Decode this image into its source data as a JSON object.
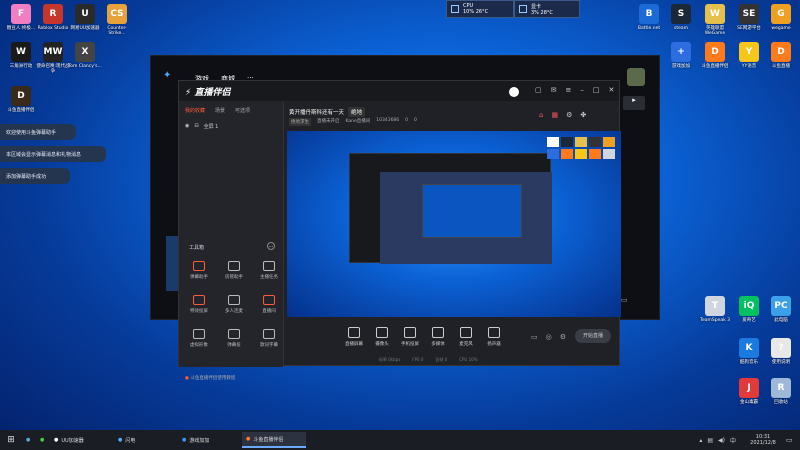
{
  "desktop_left": [
    {
      "label": "糖豆人:终极...",
      "color": "#f27ec2",
      "glyph": "F"
    },
    {
      "label": "Roblox Studio",
      "color": "#c6362b",
      "glyph": "R"
    },
    {
      "label": "网易UU加速器",
      "color": "#2a2a2a",
      "glyph": "U"
    },
    {
      "label": "Counter-Strike...",
      "color": "#e8a23a",
      "glyph": "CS"
    },
    {
      "label": "三角洲行动",
      "color": "#1a1a1a",
      "glyph": "W"
    },
    {
      "label": "使命召唤:现代战争",
      "color": "#222",
      "glyph": "MW"
    },
    {
      "label": "Tom Clancy's...",
      "color": "#444",
      "glyph": "X"
    },
    {
      "label": "斗鱼直播伴侣",
      "color": "#3a2a1a",
      "glyph": "D"
    }
  ],
  "desktop_right": [
    {
      "label": "Battle.net",
      "color": "#1b6ad6",
      "glyph": "B"
    },
    {
      "label": "steam",
      "color": "#1b2838",
      "glyph": "S"
    },
    {
      "label": "英雄联盟WeGame",
      "color": "#e5c04a",
      "glyph": "W"
    },
    {
      "label": "SE网游平台",
      "color": "#333",
      "glyph": "SE"
    },
    {
      "label": "wegame",
      "color": "#f0a020",
      "glyph": "G"
    },
    {
      "label": "游戏加加",
      "color": "#2d6de0",
      "glyph": "+"
    },
    {
      "label": "斗鱼直播伴侣",
      "color": "#ff7a1a",
      "glyph": "D"
    },
    {
      "label": "YY语音",
      "color": "#f7c61a",
      "glyph": "Y"
    },
    {
      "label": "斗鱼直播",
      "color": "#ff7a1a",
      "glyph": "D"
    },
    {
      "label": "TeamSpeak 3",
      "color": "#cfd6e0",
      "glyph": "T"
    },
    {
      "label": "爱奇艺",
      "color": "#00c060",
      "glyph": "iQ"
    },
    {
      "label": "此电脑",
      "color": "#3aa0e8",
      "glyph": "PC"
    },
    {
      "label": "酷狗音乐",
      "color": "#1a7ae0",
      "glyph": "K"
    },
    {
      "label": "使用说明",
      "color": "#e8e8e8",
      "glyph": "?"
    },
    {
      "label": "金山毒霸",
      "color": "#e03a3a",
      "glyph": "J"
    },
    {
      "label": "回收站",
      "color": "#9fb8d8",
      "glyph": "R"
    }
  ],
  "perf": {
    "cpu_label": "CPU",
    "cpu_value": "10%  26°C",
    "gpu_label": "显卡",
    "gpu_value": "3%  28°C"
  },
  "toasts": [
    "欢迎使用斗鱼弹幕助手",
    "本区域会显示弹幕消息和礼物消息",
    "添加弹幕助手成功"
  ],
  "back_window": {
    "tabs": [
      "游戏",
      "商城"
    ]
  },
  "main_window": {
    "app_name": "直播伴侣",
    "left_tabs": [
      "我的收藏",
      "场景",
      "可选项"
    ],
    "scene_item": "全屏 1",
    "room_title": "黄开播丹斯科还有一天",
    "room_tag": "绝地",
    "stream_info": [
      "绝地求生",
      "直播未开启",
      "Kane直播间",
      "10343686",
      "0",
      "0"
    ],
    "toolbox_title": "工具箱",
    "tools": [
      {
        "label": "弹幕助手",
        "color": "#ff5a3a"
      },
      {
        "label": "房管助手",
        "color": "#bbb"
      },
      {
        "label": "主播任务",
        "color": "#bbb"
      },
      {
        "label": "特效投屏",
        "color": "#ff5a3a"
      },
      {
        "label": "多人连麦",
        "color": "#bbb"
      },
      {
        "label": "直播间",
        "color": "#ff5a3a"
      },
      {
        "label": "虚拟形象",
        "color": "#bbb"
      },
      {
        "label": "弹幕投",
        "color": "#bbb"
      },
      {
        "label": "歌词字幕",
        "color": "#bbb"
      }
    ],
    "controls": [
      "直播屏幕",
      "摄像头",
      "手机投屏",
      "多媒体",
      "麦克风",
      "扬声器"
    ],
    "start_button": "开始直播",
    "status_hint": "斗鱼直播伴侣使用教程",
    "status_bar": [
      "码率 0kbps",
      "FPS 0",
      "丢帧 0",
      "CPU 10%"
    ]
  },
  "taskbar": {
    "items": [
      "UU加速器",
      "闪电",
      "游戏加加",
      "斗鱼直播伴侣"
    ],
    "time": "10:31",
    "date": "2021/12/8"
  }
}
